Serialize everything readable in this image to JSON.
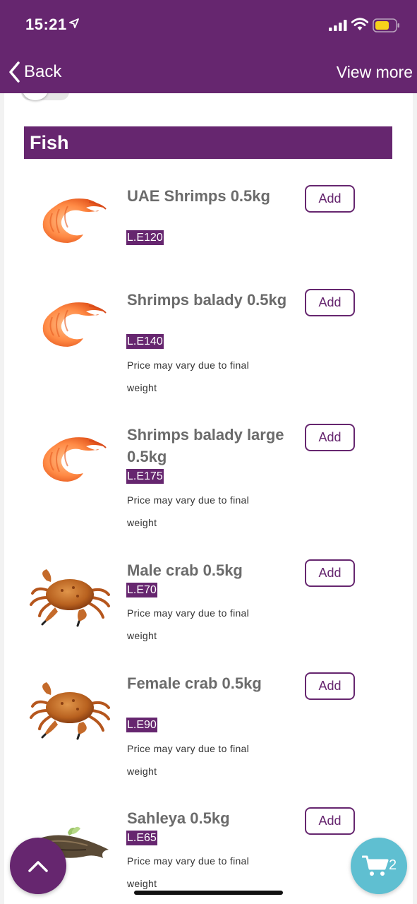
{
  "status_bar": {
    "time": "15:21"
  },
  "nav": {
    "back_label": "Back",
    "view_more_label": "View more"
  },
  "section": {
    "title": "Fish"
  },
  "products": [
    {
      "name": "UAE Shrimps 0.5kg",
      "price": "L.E120",
      "note": "",
      "add_label": "Add",
      "image": "shrimp"
    },
    {
      "name": "Shrimps balady 0.5kg",
      "price": "L.E140",
      "note": "Price may vary due to final weight",
      "add_label": "Add",
      "image": "shrimp"
    },
    {
      "name": "Shrimps balady large 0.5kg",
      "price": "L.E175",
      "note": "Price may vary due to final weight",
      "add_label": "Add",
      "image": "shrimp"
    },
    {
      "name": "Male crab 0.5kg",
      "price": "L.E70",
      "note": "Price may vary due to final weight",
      "add_label": "Add",
      "image": "crab"
    },
    {
      "name": "Female crab 0.5kg",
      "price": "L.E90",
      "note": "Price may vary due to final weight",
      "add_label": "Add",
      "image": "crab"
    },
    {
      "name": "Sahleya 0.5kg",
      "price": "L.E65",
      "note": "Price may vary due to final weight",
      "add_label": "Add",
      "image": "fish"
    }
  ],
  "cart": {
    "count": "2"
  },
  "colors": {
    "brand": "#66266f",
    "cart_fab": "#5fbfd1",
    "product_name": "#6b6b6b"
  },
  "icons": [
    "location-arrow-icon",
    "signal-icon",
    "wifi-icon",
    "battery-icon",
    "chevron-left-icon",
    "chevron-up-icon",
    "cart-icon"
  ]
}
